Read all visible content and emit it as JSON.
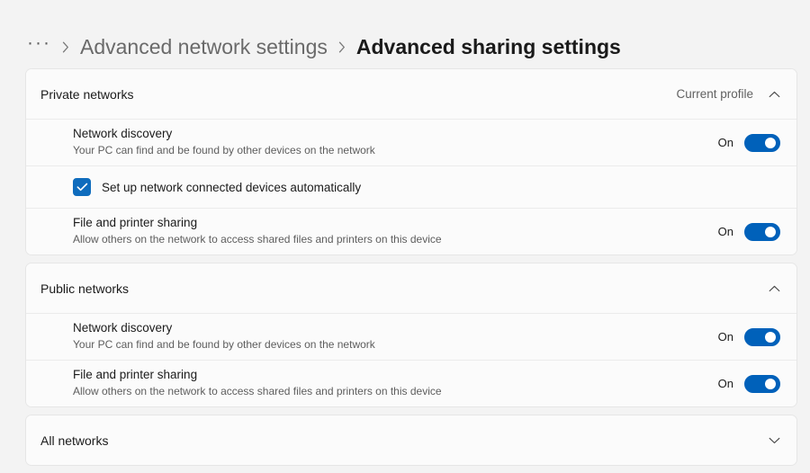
{
  "breadcrumb": {
    "ellipsis": "···",
    "parent": "Advanced network settings",
    "current": "Advanced sharing settings"
  },
  "colors": {
    "accent": "#0061ba",
    "checkbox": "#0f6cbd",
    "page_bg": "#f3f3f3",
    "card_bg": "#fbfbfb"
  },
  "sections": [
    {
      "title": "Private networks",
      "note": "Current profile",
      "chevron": "chevron-up-icon",
      "expanded": true,
      "rows": [
        {
          "title": "Network discovery",
          "desc": "Your PC can find and be found by other devices on the network",
          "toggle_label": "On",
          "toggle_state": "on"
        },
        {
          "title": "File and printer sharing",
          "desc": "Allow others on the network to access shared files and printers on this device",
          "toggle_label": "On",
          "toggle_state": "on"
        }
      ],
      "checkbox": {
        "label": "Set up network connected devices automatically",
        "checked": true
      }
    },
    {
      "title": "Public networks",
      "note": "",
      "chevron": "chevron-up-icon",
      "expanded": true,
      "rows": [
        {
          "title": "Network discovery",
          "desc": "Your PC can find and be found by other devices on the network",
          "toggle_label": "On",
          "toggle_state": "on"
        },
        {
          "title": "File and printer sharing",
          "desc": "Allow others on the network to access shared files and printers on this device",
          "toggle_label": "On",
          "toggle_state": "on"
        }
      ]
    },
    {
      "title": "All networks",
      "note": "",
      "chevron": "chevron-down-icon",
      "expanded": false,
      "rows": []
    }
  ]
}
